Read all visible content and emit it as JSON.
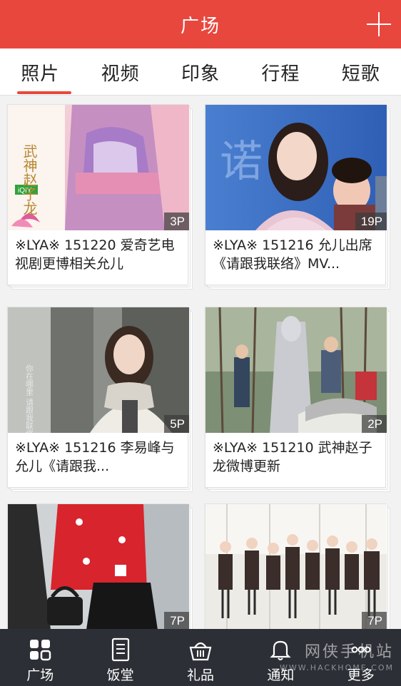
{
  "header": {
    "title": "广场",
    "add_icon": "plus-icon"
  },
  "tabs": [
    {
      "label": "照片",
      "active": true
    },
    {
      "label": "视频",
      "active": false
    },
    {
      "label": "印象",
      "active": false
    },
    {
      "label": "行程",
      "active": false
    },
    {
      "label": "短歌",
      "active": false
    }
  ],
  "cards": [
    {
      "caption": "※LYA※ 151220 爱奇艺电视剧更博相关允儿",
      "count": "3P",
      "overlay_text": "武神赵子龙",
      "overlay_brand": "iQIY"
    },
    {
      "caption": "※LYA※ 151216 允儿出席《请跟我联络》MV...",
      "count": "19P",
      "overlay_text": "诺"
    },
    {
      "caption": "※LYA※ 151216 李易峰与允儿《请跟我...",
      "count": "5P",
      "overlay_text": "你在哪里 请跟我联络"
    },
    {
      "caption": "※LYA※ 151210 武神赵子龙微博更新",
      "count": "2P"
    },
    {
      "caption": "",
      "count": "7P"
    },
    {
      "caption": "",
      "count": "7P"
    }
  ],
  "bottom_nav": [
    {
      "label": "广场",
      "icon": "grid-icon",
      "active": true
    },
    {
      "label": "饭堂",
      "icon": "document-icon",
      "active": false
    },
    {
      "label": "礼品",
      "icon": "basket-icon",
      "active": false
    },
    {
      "label": "通知",
      "icon": "bell-icon",
      "active": false
    },
    {
      "label": "更多",
      "icon": "more-icon",
      "active": false
    }
  ],
  "watermark": {
    "text": "网侠手机站",
    "sub": "WWW.HACKHOME.COM"
  },
  "colors": {
    "accent": "#e8473e",
    "nav_bg": "#2c2f35"
  }
}
